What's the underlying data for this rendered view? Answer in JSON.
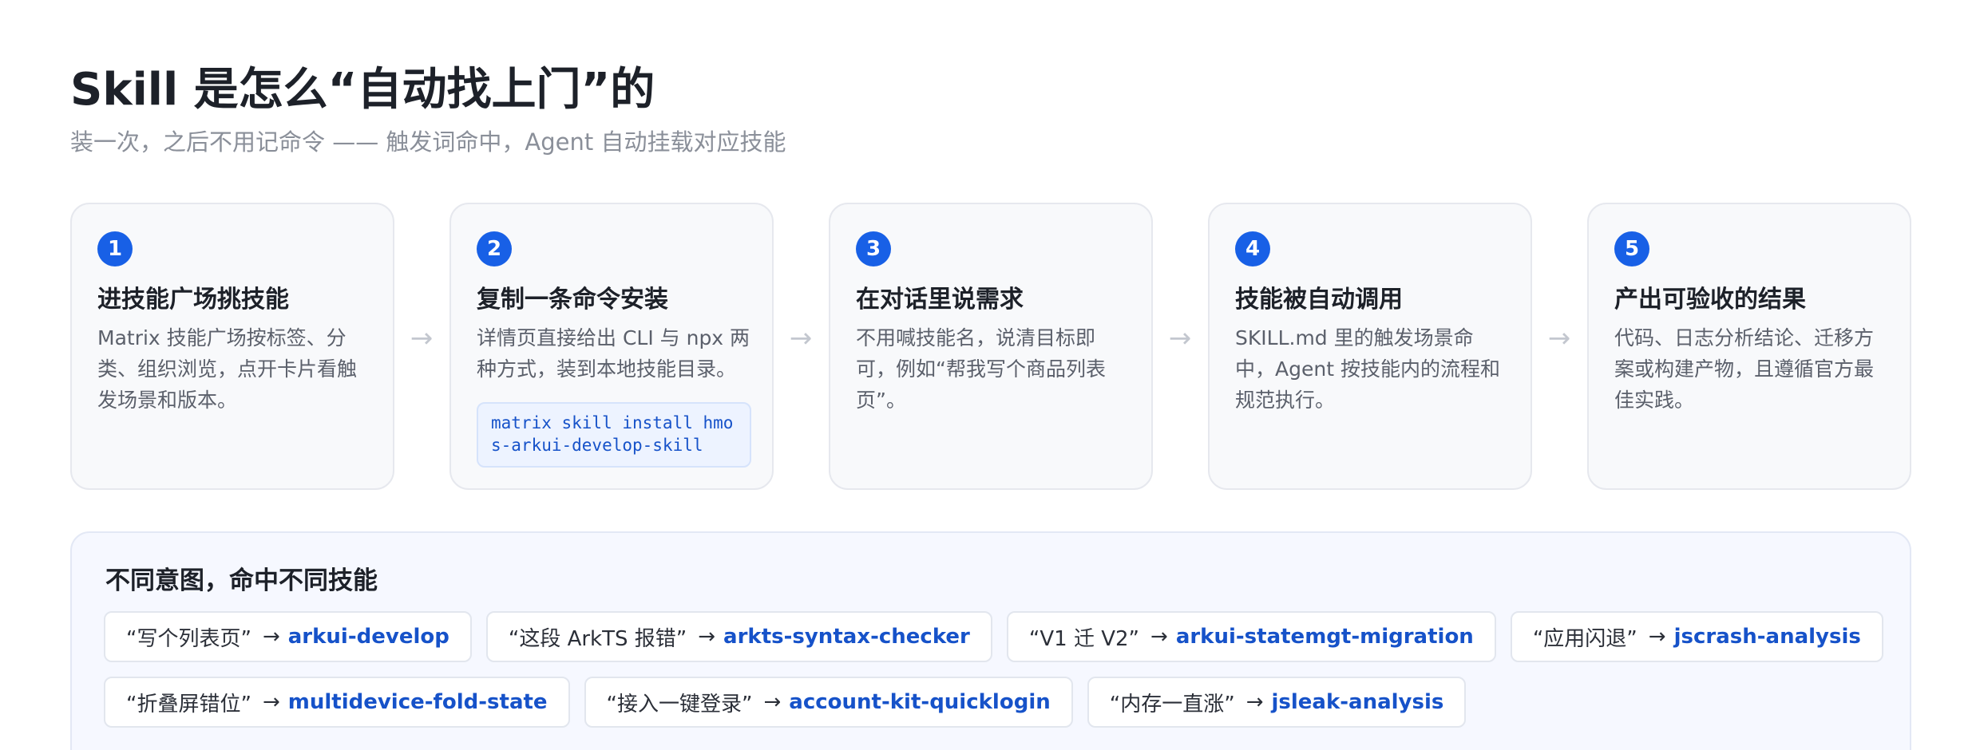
{
  "header": {
    "title": "Skill 是怎么“自动找上门”的",
    "subtitle": "装一次，之后不用记命令 —— 触发词命中，Agent 自动挂载对应技能"
  },
  "steps": [
    {
      "number": "1",
      "title": "进技能广场挑技能",
      "desc": "Matrix 技能广场按标签、分类、组织浏览，点开卡片看触发场景和版本。"
    },
    {
      "number": "2",
      "title": "复制一条命令安装",
      "desc": "详情页直接给出 CLI 与 npx 两种方式，装到本地技能目录。",
      "code": "matrix skill install hmos-arkui-develop-skill"
    },
    {
      "number": "3",
      "title": "在对话里说需求",
      "desc": "不用喊技能名，说清目标即可，例如“帮我写个商品列表页”。"
    },
    {
      "number": "4",
      "title": "技能被自动调用",
      "desc": "SKILL.md 里的触发场景命中，Agent 按技能内的流程和规范执行。"
    },
    {
      "number": "5",
      "title": "产出可验收的结果",
      "desc": "代码、日志分析结论、迁移方案或构建产物，且遵循官方最佳实践。"
    }
  ],
  "arrow_glyph": "→",
  "intents": {
    "title": "不同意图，命中不同技能",
    "arrow": "→",
    "row1": [
      {
        "query": "“写个列表页”",
        "skill": "arkui-develop"
      },
      {
        "query": "“这段 ArkTS 报错”",
        "skill": "arkts-syntax-checker"
      },
      {
        "query": "“V1 迁 V2”",
        "skill": "arkui-statemgt-migration"
      },
      {
        "query": "“应用闪退”",
        "skill": "jscrash-analysis"
      }
    ],
    "row2": [
      {
        "query": "“折叠屏错位”",
        "skill": "multidevice-fold-state"
      },
      {
        "query": "“接入一键登录”",
        "skill": "account-kit-quicklogin"
      },
      {
        "query": "“内存一直涨”",
        "skill": "jsleak-analysis"
      }
    ]
  }
}
